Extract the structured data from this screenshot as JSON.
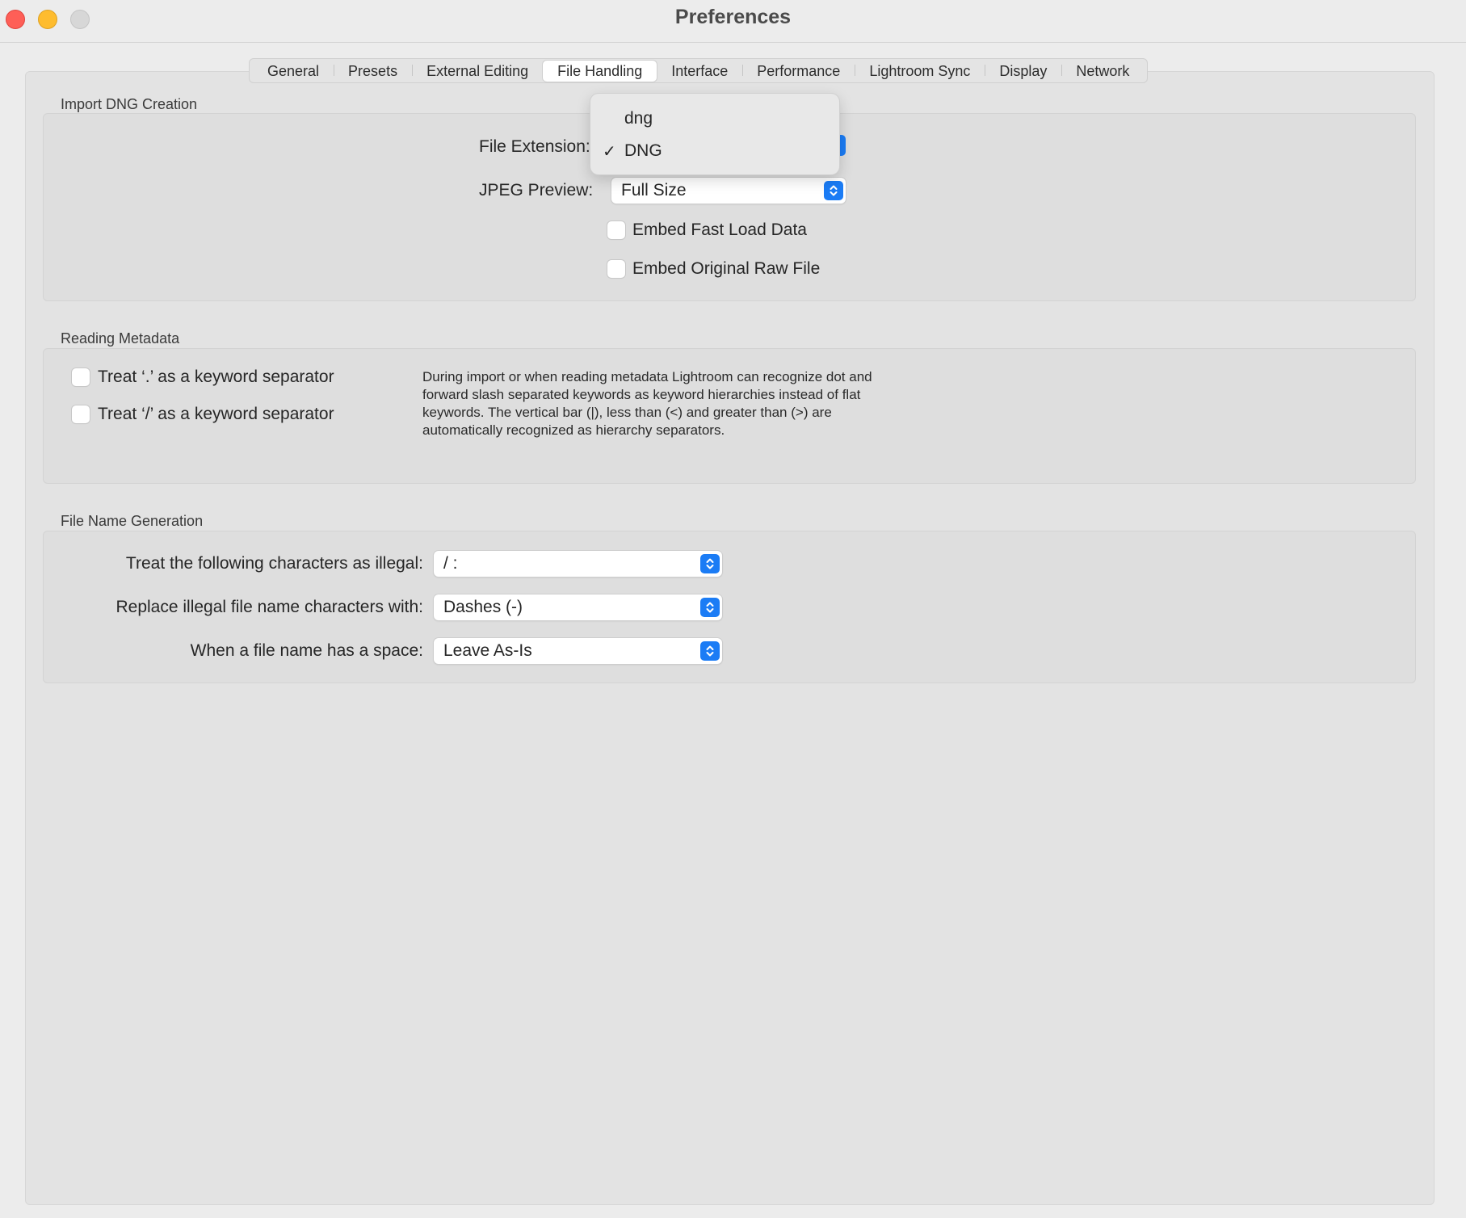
{
  "window": {
    "title": "Preferences"
  },
  "tabs": [
    {
      "label": "General"
    },
    {
      "label": "Presets"
    },
    {
      "label": "External Editing"
    },
    {
      "label": "File Handling",
      "active": true
    },
    {
      "label": "Interface"
    },
    {
      "label": "Performance"
    },
    {
      "label": "Lightroom Sync"
    },
    {
      "label": "Display"
    },
    {
      "label": "Network"
    }
  ],
  "import_dng": {
    "title": "Import DNG Creation",
    "file_extension_label": "File Extension:",
    "file_extension_value": "DNG",
    "jpeg_preview_label": "JPEG Preview:",
    "jpeg_preview_value": "Full Size",
    "embed_fast_load_label": "Embed Fast Load Data",
    "embed_fast_load_checked": false,
    "embed_original_raw_label": "Embed Original Raw File",
    "embed_original_raw_checked": false
  },
  "file_extension_menu": {
    "options": [
      {
        "label": "dng",
        "checked": false
      },
      {
        "label": "DNG",
        "checked": true
      }
    ],
    "check_glyph": "✓"
  },
  "reading_metadata": {
    "title": "Reading Metadata",
    "dot_separator_label": "Treat ‘.’ as a keyword separator",
    "dot_separator_checked": false,
    "slash_separator_label": "Treat ‘/’ as a keyword separator",
    "slash_separator_checked": false,
    "help_text": "During import or when reading metadata Lightroom can recognize dot and forward slash separated keywords as keyword hierarchies instead of flat keywords. The vertical bar (|), less than (<) and greater than (>) are automatically recognized as hierarchy separators."
  },
  "file_name_generation": {
    "title": "File Name Generation",
    "illegal_chars_label": "Treat the following characters as illegal:",
    "illegal_chars_value": "/ :",
    "replace_label": "Replace illegal file name characters with:",
    "replace_value": "Dashes (-)",
    "space_label": "When a file name has a space:",
    "space_value": "Leave As-Is"
  },
  "colors": {
    "accent": "#1b7cf5",
    "close": "#fe5f57",
    "minimize": "#febc2e",
    "zoom_disabled": "#d7d7d7"
  }
}
